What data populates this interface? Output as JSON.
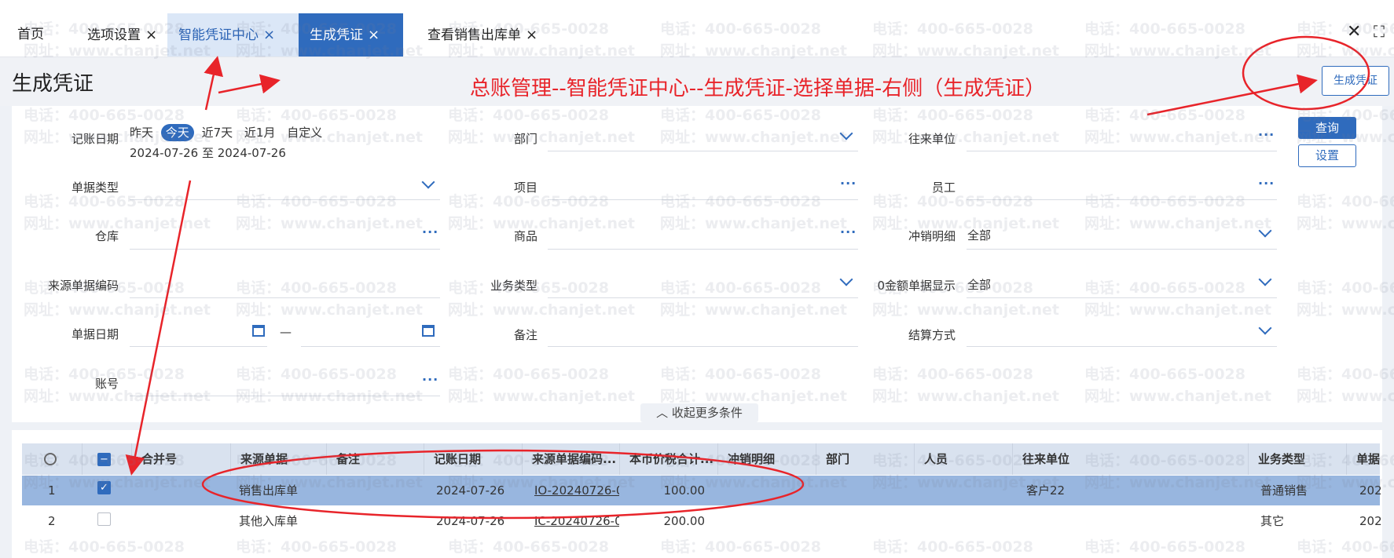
{
  "tabs": [
    {
      "label": "首页",
      "closable": false
    },
    {
      "label": "选项设置",
      "closable": true
    },
    {
      "label": "智能凭证中心",
      "closable": true
    },
    {
      "label": "生成凭证",
      "closable": true
    },
    {
      "label": "查看销售出库单",
      "closable": true
    }
  ],
  "tab_close_glyph": "×",
  "window": {
    "close_glyph": "✕",
    "fullscreen_glyph": "⛶"
  },
  "page_title": "生成凭证",
  "annotation": "总账管理--智能凭证中心--生成凭证-选择单据-右侧（生成凭证）",
  "buttons": {
    "generate": "生成凭证",
    "query": "查询",
    "settings": "设置"
  },
  "filters": {
    "posting_date": {
      "label": "记账日期",
      "quick": [
        "昨天",
        "今天",
        "近7天",
        "近1月",
        "自定义"
      ],
      "selected": "今天",
      "range_text": "2024-07-26 至 2024-07-26"
    },
    "dept": "部门",
    "partner": "往来单位",
    "doc_type": "单据类型",
    "project": "项目",
    "employee": "员工",
    "warehouse": "仓库",
    "goods": "商品",
    "offset_detail": {
      "label": "冲销明细",
      "value": "全部"
    },
    "source_code": "来源单据编码",
    "biz_type": "业务类型",
    "zero_amount": {
      "label": "0金额单据显示",
      "value": "全部"
    },
    "doc_date": {
      "label": "单据日期",
      "sep": "—"
    },
    "remark": "备注",
    "settle": "结算方式",
    "account": "账号"
  },
  "collapse_label": "收起更多条件",
  "table": {
    "columns": [
      "合并号",
      "来源单据",
      "备注",
      "记账日期",
      "来源单据编码...",
      "本币价税合计...",
      "冲销明细",
      "部门",
      "人员",
      "往来单位",
      "业务类型",
      "单据"
    ],
    "rows": [
      {
        "no": "1",
        "checked": true,
        "merge": "",
        "source": "销售出库单",
        "remark": "",
        "date": "2024-07-26",
        "code": "IO-20240726-0",
        "amount": "100.00",
        "offset": "",
        "dept": "",
        "person": "",
        "partner": "客户22",
        "biz": "普通销售",
        "doc": "202"
      },
      {
        "no": "2",
        "checked": false,
        "merge": "",
        "source": "其他入库单",
        "remark": "",
        "date": "2024-07-26",
        "code": "IC-20240726-0",
        "amount": "200.00",
        "offset": "",
        "dept": "",
        "person": "",
        "partner": "",
        "biz": "其它",
        "doc": "202"
      }
    ]
  },
  "watermark": {
    "phone": "电话：400-665-0028",
    "site": "网址：www.chanjet.net"
  },
  "colors": {
    "accent": "#2f6bbd",
    "annotation": "#e8242a",
    "selected_row": "#98b6df"
  }
}
